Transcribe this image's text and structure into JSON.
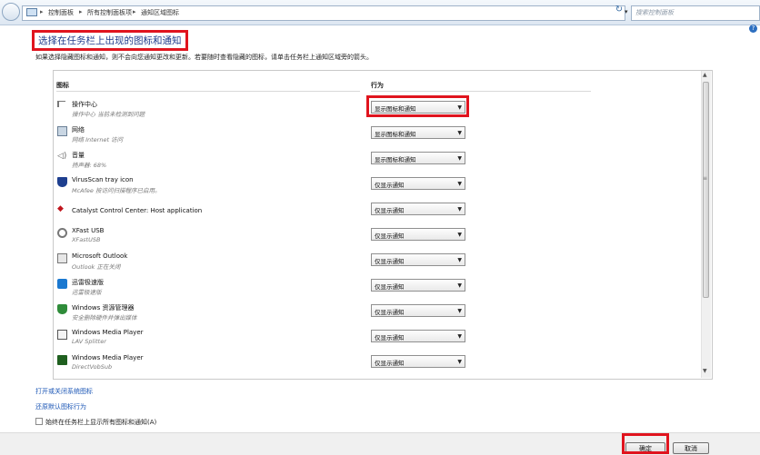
{
  "address_bar": {
    "breadcrumbs": [
      "控制面板",
      "所有控制面板项",
      "通知区域图标"
    ],
    "search_placeholder": "搜索控制面板"
  },
  "page": {
    "title": "选择在任务栏上出现的图标和通知",
    "description": "如果选择隐藏图标和通知，则不会向您通知更改和更新。若要随时查看隐藏的图标，请单击任务栏上通知区域旁的箭头。"
  },
  "table": {
    "col_icon": "图标",
    "col_behavior": "行为",
    "rows": [
      {
        "name": "操作中心",
        "sub": "操作中心 当前未检测到问题",
        "behavior": "显示图标和通知",
        "icon": "flag-icon"
      },
      {
        "name": "网络",
        "sub": "网络 Internet 访问",
        "behavior": "显示图标和通知",
        "icon": "network-icon"
      },
      {
        "name": "音量",
        "sub": "扬声器: 68%",
        "behavior": "显示图标和通知",
        "icon": "speaker-icon"
      },
      {
        "name": "VirusScan tray icon",
        "sub": "McAfee 按访问扫描程序已启用。",
        "behavior": "仅显示通知",
        "icon": "shield-icon"
      },
      {
        "name": "Catalyst Control Center: Host application",
        "sub": "",
        "behavior": "仅显示通知",
        "icon": "ati-icon"
      },
      {
        "name": "XFast USB",
        "sub": "XFastUSB",
        "behavior": "仅显示通知",
        "icon": "usb-icon"
      },
      {
        "name": "Microsoft Outlook",
        "sub": "Outlook 正在关闭",
        "behavior": "仅显示通知",
        "icon": "outlook-icon"
      },
      {
        "name": "迅雷极速版",
        "sub": "迅雷极速版",
        "behavior": "仅显示通知",
        "icon": "thunder-icon"
      },
      {
        "name": "Windows 资源管理器",
        "sub": "安全删除硬件并弹出媒体",
        "behavior": "仅显示通知",
        "icon": "usb-eject-icon"
      },
      {
        "name": "Windows Media Player",
        "sub": "LAV Splitter",
        "behavior": "仅显示通知",
        "icon": "lav-icon"
      },
      {
        "name": "Windows Media Player",
        "sub": "DirectVobSub",
        "behavior": "仅显示通知",
        "icon": "vobsub-icon"
      }
    ]
  },
  "links": {
    "toggle_system_icons": "打开或关闭系统图标",
    "restore_defaults": "还原默认图标行为"
  },
  "checkbox": {
    "label": "始终在任务栏上显示所有图标和通知(A)",
    "checked": false
  },
  "buttons": {
    "ok": "确定",
    "cancel": "取消"
  },
  "colors": {
    "highlight": "#e0141e",
    "link": "#1a55b5",
    "title": "#1e3a8a"
  }
}
